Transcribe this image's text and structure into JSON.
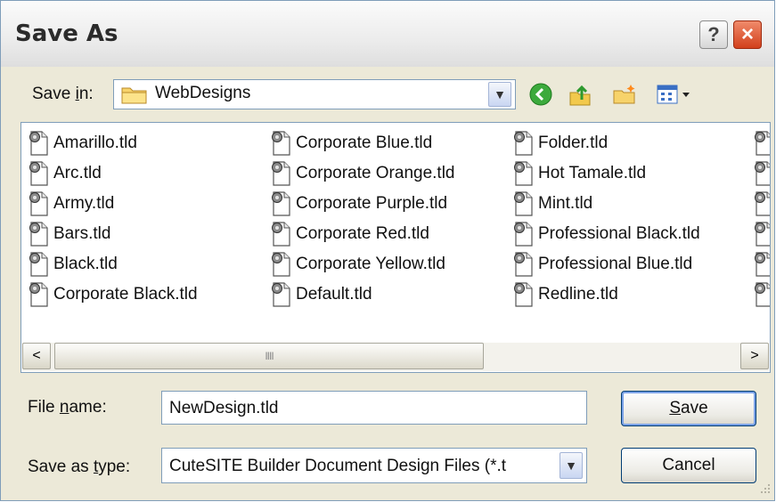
{
  "window": {
    "title": "Save As",
    "help_icon": "?",
    "close_icon": "×"
  },
  "save_in": {
    "label_pre": "Save ",
    "label_key": "i",
    "label_post": "n:",
    "value": "WebDesigns",
    "nav_icons": [
      "back-arrow-icon",
      "up-folder-icon",
      "new-folder-icon",
      "view-menu-icon"
    ]
  },
  "files": [
    [
      "Amarillo.tld",
      "Arc.tld",
      "Army.tld",
      "Bars.tld",
      "Black.tld",
      "Corporate Black.tld"
    ],
    [
      "Corporate Blue.tld",
      "Corporate Orange.tld",
      "Corporate Purple.tld",
      "Corporate Red.tld",
      "Corporate Yellow.tld",
      "Default.tld"
    ],
    [
      "Folder.tld",
      "Hot Tamale.tld",
      "Mint.tld",
      "Professional Black.tld",
      "Professional Blue.tld",
      "Redline.tld"
    ]
  ],
  "scroll": {
    "left_arrow": "<",
    "right_arrow": ">",
    "thumb_grip": "IIII",
    "position": 0.0
  },
  "file_name": {
    "label_pre": "File ",
    "label_key": "n",
    "label_post": "ame:",
    "value": "NewDesign.tld"
  },
  "save_type": {
    "label_pre": "Save as ",
    "label_key": "t",
    "label_post": "ype:",
    "value": "CuteSITE Builder Document Design Files (*.t"
  },
  "buttons": {
    "save_key": "S",
    "save_rest": "ave",
    "cancel": "Cancel"
  },
  "colors": {
    "dialog_bg": "#ece9d8",
    "border": "#7f9db9",
    "close_red": "#d2401c"
  }
}
